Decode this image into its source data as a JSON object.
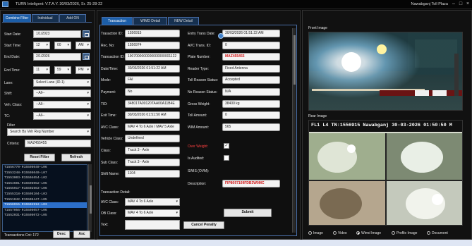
{
  "window": {
    "title": "TURN Inteligent: V.T.A.Y. 30/03/2026, Sr. 25-28-22",
    "user": "Nawabganj Toll Plaza"
  },
  "left_tabs": [
    "Combine Filter",
    "Individual",
    "Add ON"
  ],
  "filter": {
    "start_date_label": "Start Date:",
    "start_date": "1/1/2023",
    "start_time_label": "Start Time:",
    "start_hour": "12",
    "start_min": "00",
    "start_ampm": "AM",
    "end_date_label": "End Date:",
    "end_date": "2/1/2026",
    "end_time_label": "End Time:",
    "end_hour": "11",
    "end_min": "59",
    "end_ampm": "PM",
    "lane_label": "Lane:",
    "lane_value": "Select Lane (ID-1)",
    "shift_label": "Shift:",
    "shift_value": "--All--",
    "vehclass_label": "Veh. Class:",
    "vehclass_value": "--All--",
    "tc_label": "TC:",
    "tc_value": "--All--",
    "filter_label": "Filter",
    "filter_value": "Search By Veh Reg Number",
    "criteria_label": "Criteria:",
    "criteria_value": "MAZ455455",
    "reset_button": "Reset Filter",
    "refresh_button": "Refresh"
  },
  "transactions": [
    "T1556770-R15505040-L06",
    "T1553248-R15505040-L07",
    "T1553003-R15504654-L02",
    "T1554601-R15505052-L05",
    "T1555917-R15502663-L06",
    "T1555318-R15505104-L03",
    "T1551042-R15505447-L05",
    "T1556915-R15504912-L03",
    "T1557056-R15505057-L06",
    "T1552031-R15505072-L05"
  ],
  "selected_transaction_index": 7,
  "footer": {
    "count_label": "Transactions Cnt: 172",
    "desc_button": "Desc",
    "asc_button": "Asc"
  },
  "mid_tabs": [
    "Transaction",
    "WIMD Detail",
    "NEW Detail"
  ],
  "details": {
    "rows_left": [
      {
        "label": "Trasaction ID:",
        "value": "1556915"
      },
      {
        "label": "Rec. No:",
        "value": "1556974"
      },
      {
        "label": "Transaction ID:",
        "value": "1907000000000000000001122"
      },
      {
        "label": "Date/Time:",
        "value": "30/03/2026 01:51:22 AM"
      },
      {
        "label": "Mode:",
        "value": "FAI"
      },
      {
        "label": "Payment:",
        "value": "No"
      },
      {
        "label": "TID:",
        "value": "34801TA00120TAA00A11B4E"
      },
      {
        "label": "Exit Time:",
        "value": "30/03/2026 01:51:50 AM"
      },
      {
        "label": "AVC Class:",
        "value": "MAV 4 To 6 Axle / MAV 5 Axle"
      },
      {
        "label": "Vehicle Class:",
        "value": "Undefined"
      },
      {
        "label": "Class:",
        "value": "Truck 3 - Axle"
      },
      {
        "label": "Sub Class:",
        "value": "Truck 3 - Axle"
      },
      {
        "label": "Shift Name:",
        "value": "1104"
      }
    ],
    "rows_right": [
      {
        "label": "Entry Trans Date:",
        "value": "30/03/2026 01:51:22 AM",
        "red": false
      },
      {
        "label": "AVC Trans. ID:",
        "value": "0",
        "red": false
      },
      {
        "label": "Plate Number:",
        "value": "MAZ455455",
        "red": true
      },
      {
        "label": "Reader Type:",
        "value": "Fixed Antenna",
        "red": false
      },
      {
        "label": "Toll Reason Status:",
        "value": "Accepted",
        "red": false
      },
      {
        "label": "No Reason Status:",
        "value": "N/A",
        "red": false
      },
      {
        "label": "Gross Weight:",
        "value": "38400 kg",
        "red": false
      },
      {
        "label": "Toll Amount:",
        "value": "0",
        "red": false
      },
      {
        "label": "WIM Amount:",
        "value": "565",
        "red": false
      }
    ],
    "over_weight_label": "Over Weight:",
    "is_audited_label": "Is Audited:",
    "swis_label": "SWIS (OVM):",
    "description_label": "Description:",
    "description_value": "FIP8097109FDB3W0MC",
    "trans_detail_label": "Transaction Detail:",
    "avc_class_label": "AVC Class:",
    "avc_class_value": "MAV 4 To 6 Axle",
    "ob_class_label": "OB Class:",
    "ob_class_value": "MAV 4 To 6 Axle",
    "text_label": "Text:",
    "submit_button": "Submit",
    "cancel_penalty_button": "Cancel Penalty"
  },
  "images": {
    "front_label": "Front Image",
    "rear_label": "Rear Image",
    "rear_overlay": "FL1 L4 TN:1556915 Nawabganj 30-03-2026 01:50:50 M"
  },
  "view_options": [
    "Image",
    "Video",
    "Wimd Image",
    "Profile Image",
    "Document"
  ],
  "view_selected": 2,
  "colors": {
    "accent": "#1c5ea8",
    "selected_row": "#2c6fc9",
    "plate_red": "#d21a1a"
  }
}
